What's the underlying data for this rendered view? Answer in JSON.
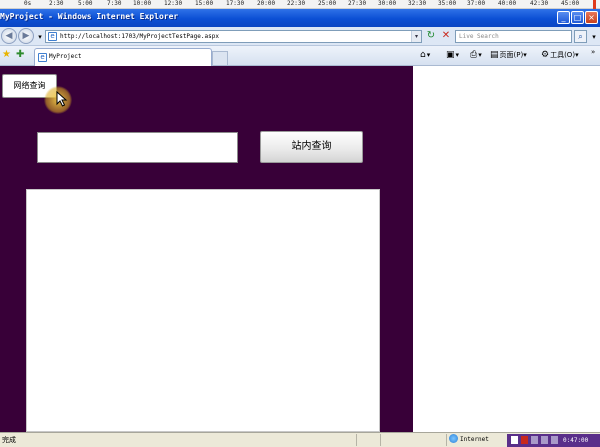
{
  "ruler": {
    "ticks": [
      "0s",
      "2:30",
      "5:00",
      "7:30",
      "10:00",
      "12:30",
      "15:00",
      "17:30",
      "20:00",
      "22:30",
      "25:00",
      "27:30",
      "30:00",
      "32:30",
      "35:00",
      "37:00",
      "40:00",
      "42:30",
      "45:00"
    ]
  },
  "window": {
    "title": "MyProject - Windows Internet Explorer",
    "minimize_label": "_",
    "maximize_label": "□",
    "close_label": "×"
  },
  "address_bar": {
    "back_glyph": "◀",
    "forward_glyph": "▶",
    "dropdown_glyph": "▾",
    "url": "http://localhost:1703/MyProjectTestPage.aspx",
    "refresh_glyph": "↻",
    "stop_glyph": "✕",
    "search_placeholder": "Live Search",
    "search_go_glyph": "⌕"
  },
  "tab_bar": {
    "tab_title": "MyProject",
    "page_menu": "页面(P)",
    "tools_menu": "工具(O)",
    "more_glyph": "»"
  },
  "page": {
    "net_query_label": "网络查询",
    "search_input_value": "",
    "site_query_label": "站内查询"
  },
  "status_bar": {
    "status_text": "完成",
    "zone_text": "Internet",
    "recorder_time": "0:47:00"
  },
  "colors": {
    "page_background": "#380038",
    "titlebar": "#0b4fd4",
    "recorder": "#5a2f8a"
  }
}
